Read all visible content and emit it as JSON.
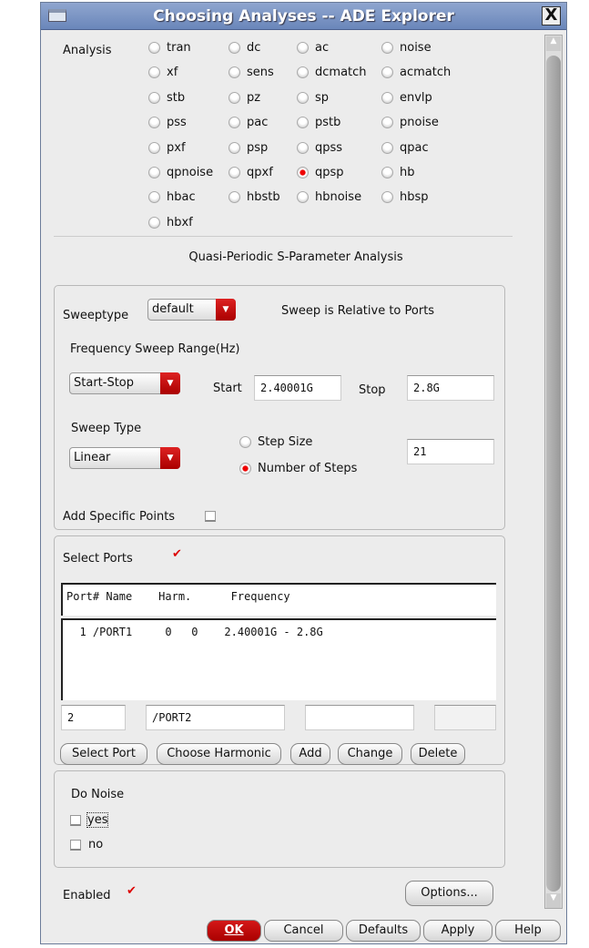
{
  "window": {
    "title": "Choosing Analyses -- ADE Explorer",
    "close": "X"
  },
  "analysis": {
    "label": "Analysis",
    "selected": "qpsp",
    "options": [
      "tran",
      "dc",
      "ac",
      "noise",
      "xf",
      "sens",
      "dcmatch",
      "acmatch",
      "stb",
      "pz",
      "sp",
      "envlp",
      "pss",
      "pac",
      "pstb",
      "pnoise",
      "pxf",
      "psp",
      "qpss",
      "qpac",
      "qpnoise",
      "qpxf",
      "qpsp",
      "hb",
      "hbac",
      "hbstb",
      "hbnoise",
      "hbsp",
      "hbxf"
    ]
  },
  "section_title": "Quasi-Periodic S-Parameter Analysis",
  "sweep": {
    "sweeptype_label": "Sweeptype",
    "sweeptype_value": "default",
    "relative_note": "Sweep is Relative to Ports",
    "range_label": "Frequency Sweep Range(Hz)",
    "range_mode": "Start-Stop",
    "start_label": "Start",
    "start_value": "2.40001G",
    "stop_label": "Stop",
    "stop_value": "2.8G",
    "type_label": "Sweep Type",
    "type_value": "Linear",
    "step_size_label": "Step Size",
    "num_steps_label": "Number of Steps",
    "num_steps_selected": true,
    "steps_value": "21",
    "add_points_label": "Add Specific Points",
    "add_points_checked": false
  },
  "ports": {
    "label": "Select Ports",
    "checked": true,
    "header": "Port# Name    Harm.      Frequency",
    "rows": [
      "  1 /PORT1     0   0    2.40001G - 2.8G"
    ],
    "entry_num": "2",
    "entry_name": "/PORT2",
    "entry_harm": "",
    "entry_freq": "",
    "buttons": [
      "Select Port",
      "Choose Harmonic",
      "Add",
      "Change",
      "Delete"
    ]
  },
  "noise": {
    "label": "Do Noise",
    "yes": "yes",
    "no": "no",
    "yes_checked": false,
    "no_checked": false
  },
  "enabled": {
    "label": "Enabled",
    "checked": true
  },
  "options_button": "Options...",
  "footer": {
    "ok": "OK",
    "cancel": "Cancel",
    "defaults": "Defaults",
    "apply": "Apply",
    "help": "Help"
  },
  "colors": {
    "accent": "#cc0000",
    "titlebar": "#7b94c4"
  }
}
